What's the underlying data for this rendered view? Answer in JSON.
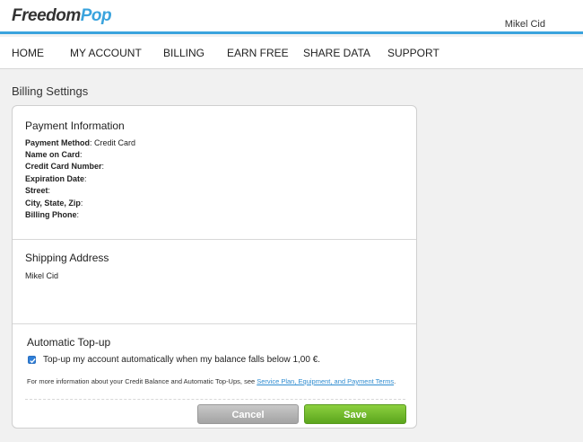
{
  "header": {
    "logo_part1": "Freedom",
    "logo_part2": "Pop",
    "user_name": "Mikel Cid"
  },
  "nav": {
    "items": [
      {
        "label": "HOME"
      },
      {
        "label": "MY ACCOUNT"
      },
      {
        "label": "BILLING"
      },
      {
        "label": "EARN FREE"
      },
      {
        "label": "SHARE DATA"
      },
      {
        "label": "SUPPORT"
      }
    ]
  },
  "page": {
    "title": "Billing Settings"
  },
  "payment": {
    "title": "Payment Information",
    "method_label": "Payment Method",
    "method_value": ": Credit Card",
    "name_label": "Name on Card",
    "name_value": ":",
    "card_label": "Credit Card Number",
    "card_value": ":",
    "exp_label": "Expiration Date",
    "exp_value": ":",
    "street_label": "Street",
    "street_value": ":",
    "city_label": "City, State, Zip",
    "city_value": ":",
    "phone_label": "Billing Phone",
    "phone_value": ":"
  },
  "shipping": {
    "title": "Shipping Address",
    "name": "Mikel Cid"
  },
  "topup": {
    "title": "Automatic Top-up",
    "checkbox_label": "Top-up my account automatically when my balance falls below 1,00 €.",
    "checked": true,
    "info_text": "For more information about your Credit Balance and Automatic Top-Ups, see ",
    "info_link": "Service Plan, Equipment, and Payment Terms",
    "info_end": "."
  },
  "buttons": {
    "cancel": "Cancel",
    "save": "Save"
  },
  "colors": {
    "accent": "#3aa3dd",
    "save_green": "#6cb82b",
    "cancel_gray": "#b3b3b3",
    "checkbox_blue": "#2f7fd8"
  }
}
